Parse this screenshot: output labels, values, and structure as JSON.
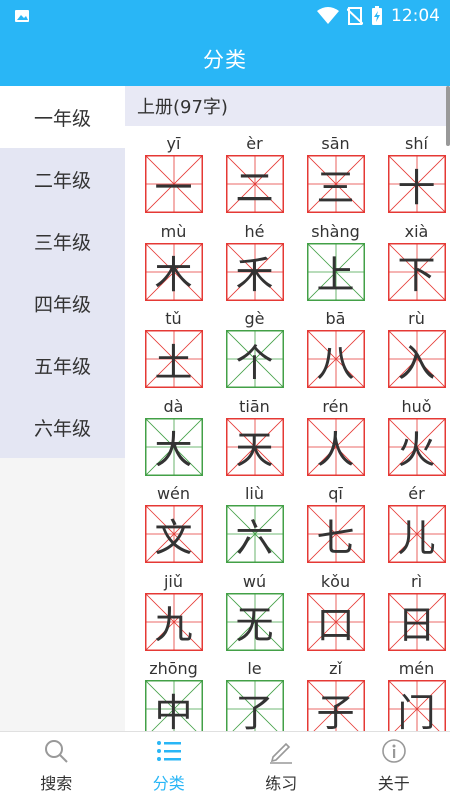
{
  "status": {
    "time": "12:04"
  },
  "appbar": {
    "title": "分类"
  },
  "sidebar": {
    "grades": [
      "一年级",
      "二年级",
      "三年级",
      "四年级",
      "五年级",
      "六年级"
    ],
    "active_index": 0
  },
  "section": {
    "title": "上册(97字)"
  },
  "characters": [
    {
      "pinyin": "yī",
      "char": "一",
      "color": "#e53935"
    },
    {
      "pinyin": "èr",
      "char": "二",
      "color": "#e53935"
    },
    {
      "pinyin": "sān",
      "char": "三",
      "color": "#e53935"
    },
    {
      "pinyin": "shí",
      "char": "十",
      "color": "#e53935"
    },
    {
      "pinyin": "mù",
      "char": "木",
      "color": "#e53935"
    },
    {
      "pinyin": "hé",
      "char": "禾",
      "color": "#e53935"
    },
    {
      "pinyin": "shàng",
      "char": "上",
      "color": "#43a047"
    },
    {
      "pinyin": "xià",
      "char": "下",
      "color": "#e53935"
    },
    {
      "pinyin": "tǔ",
      "char": "土",
      "color": "#e53935"
    },
    {
      "pinyin": "gè",
      "char": "个",
      "color": "#43a047"
    },
    {
      "pinyin": "bā",
      "char": "八",
      "color": "#e53935"
    },
    {
      "pinyin": "rù",
      "char": "入",
      "color": "#e53935"
    },
    {
      "pinyin": "dà",
      "char": "大",
      "color": "#43a047"
    },
    {
      "pinyin": "tiān",
      "char": "天",
      "color": "#e53935"
    },
    {
      "pinyin": "rén",
      "char": "人",
      "color": "#e53935"
    },
    {
      "pinyin": "huǒ",
      "char": "火",
      "color": "#e53935"
    },
    {
      "pinyin": "wén",
      "char": "文",
      "color": "#e53935"
    },
    {
      "pinyin": "liù",
      "char": "六",
      "color": "#43a047"
    },
    {
      "pinyin": "qī",
      "char": "七",
      "color": "#e53935"
    },
    {
      "pinyin": "ér",
      "char": "儿",
      "color": "#e53935"
    },
    {
      "pinyin": "jiǔ",
      "char": "九",
      "color": "#e53935"
    },
    {
      "pinyin": "wú",
      "char": "无",
      "color": "#43a047"
    },
    {
      "pinyin": "kǒu",
      "char": "口",
      "color": "#e53935"
    },
    {
      "pinyin": "rì",
      "char": "日",
      "color": "#e53935"
    },
    {
      "pinyin": "zhōng",
      "char": "中",
      "color": "#43a047"
    },
    {
      "pinyin": "le",
      "char": "了",
      "color": "#43a047"
    },
    {
      "pinyin": "zǐ",
      "char": "子",
      "color": "#e53935"
    },
    {
      "pinyin": "mén",
      "char": "门",
      "color": "#e53935"
    }
  ],
  "tabbar": {
    "items": [
      {
        "label": "搜索",
        "icon": "search-icon"
      },
      {
        "label": "分类",
        "icon": "list-icon"
      },
      {
        "label": "练习",
        "icon": "pencil-icon"
      },
      {
        "label": "关于",
        "icon": "info-icon"
      }
    ],
    "active_index": 1
  },
  "colors": {
    "accent": "#29b6f6",
    "grid_red": "#e53935",
    "grid_green": "#43a047"
  }
}
